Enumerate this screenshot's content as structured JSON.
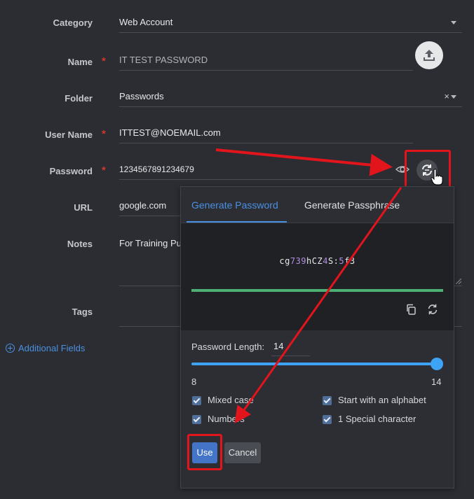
{
  "form": {
    "category": {
      "label": "Category",
      "value": "Web Account"
    },
    "name": {
      "label": "Name",
      "value": "IT TEST PASSWORD"
    },
    "folder": {
      "label": "Folder",
      "value": "Passwords",
      "clear": "×"
    },
    "username": {
      "label": "User Name",
      "value": "ITTEST@NOEMAIL.com"
    },
    "password": {
      "label": "Password",
      "value": "1234567891234679"
    },
    "url": {
      "label": "URL",
      "value": "google.com"
    },
    "notes": {
      "label": "Notes",
      "value": "For Training Pu"
    },
    "tags": {
      "label": "Tags"
    },
    "required_mark": "*",
    "additional_fields": "Additional Fields"
  },
  "generator": {
    "tabs": [
      "Generate Password",
      "Generate Passphrase"
    ],
    "active_tab": 0,
    "generated": {
      "p1": "cg",
      "d1": "739",
      "p2": "hCZ",
      "d2": "4",
      "p3": "S:",
      "d3": "5",
      "p4": "f3"
    },
    "length_label": "Password Length:",
    "length_value": "14",
    "length_min": "8",
    "length_max": "14",
    "length_fraction": 1.0,
    "options": [
      {
        "label": "Mixed case",
        "checked": true
      },
      {
        "label": "Start with an alphabet",
        "checked": true
      },
      {
        "label": "Numbers",
        "checked": true
      },
      {
        "label": "1 Special character",
        "checked": true
      }
    ],
    "use_label": "Use",
    "cancel_label": "Cancel"
  },
  "icons": [
    "upload-icon",
    "eye-icon",
    "generate-password-icon",
    "copy-icon",
    "regenerate-icon",
    "plus-circle-icon",
    "hand-cursor-icon"
  ],
  "colors": {
    "accent": "#4a90e2",
    "strength": "#4caf73",
    "annotation": "#e2141c",
    "use_button": "#4474c8"
  }
}
